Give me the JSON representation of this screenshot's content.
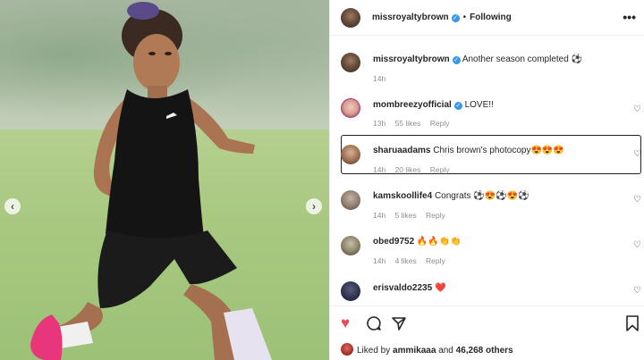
{
  "post": {
    "author": "missroyaltybrown",
    "follow_state": "Following",
    "separator": "•",
    "more_glyph": "•••"
  },
  "caption": {
    "username": "missroyaltybrown",
    "text": "Another season completed ⚽",
    "time": "14h"
  },
  "comments": [
    {
      "username": "mombreezyofficial",
      "verified": true,
      "text": "LOVE!!",
      "time": "13h",
      "likes": "55 likes",
      "reply": "Reply"
    },
    {
      "username": "sharuaadams",
      "verified": false,
      "text": "Chris brown's photocopy😍😍😍",
      "time": "14h",
      "likes": "20 likes",
      "reply": "Reply"
    },
    {
      "username": "kamskoollife4",
      "verified": false,
      "text": "Congrats ⚽😍⚽😍⚽",
      "time": "14h",
      "likes": "5 likes",
      "reply": "Reply"
    },
    {
      "username": "obed9752",
      "verified": false,
      "text": "🔥🔥👏👏",
      "time": "14h",
      "likes": "4 likes",
      "reply": "Reply"
    },
    {
      "username": "erisvaldo2235",
      "verified": false,
      "text": "❤️",
      "time": "",
      "likes": "",
      "reply": ""
    }
  ],
  "footer": {
    "liked_prefix": "Liked by",
    "liked_user": "ammikaaa",
    "liked_and": "and",
    "liked_count": "46,268 others"
  },
  "media": {
    "prev_glyph": "‹",
    "next_glyph": "›"
  },
  "icons": {
    "like": "heart-icon",
    "comment": "comment-icon",
    "share": "share-icon",
    "save": "bookmark-icon"
  },
  "colors": {
    "like_red": "#ed4956",
    "verified_blue": "#3897f0",
    "meta_grey": "#8e8e8e"
  }
}
